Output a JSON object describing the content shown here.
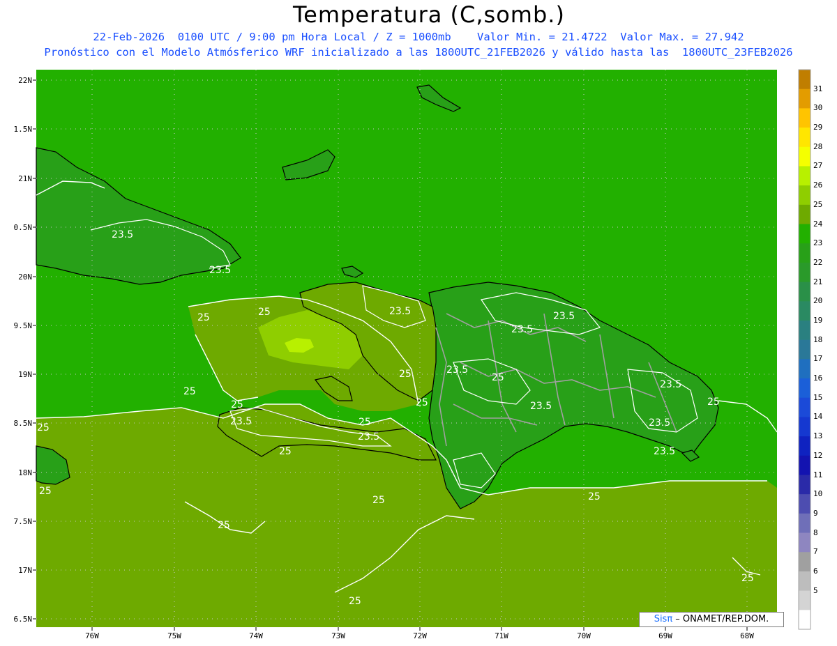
{
  "title": "Temperatura (C,somb.)",
  "subtitle_line1": "22-Feb-2026  0100 UTC / 9:00 pm Hora Local / Z = 1000mb    Valor Min. = 21.4722  Valor Max. = 27.942",
  "subtitle_line2": "Pronóstico con el Modelo Atmósferico WRF inicializado a las 1800UTC_21FEB2026 y válido hasta las  1800UTC_23FEB2026",
  "y_axis_labels": [
    "22N",
    "1.5N",
    "21N",
    "0.5N",
    "20N",
    "9.5N",
    "19N",
    "8.5N",
    "18N",
    "7.5N",
    "17N",
    "6.5N"
  ],
  "x_axis_labels": [
    "76W",
    "75W",
    "74W",
    "73W",
    "72W",
    "71W",
    "70W",
    "69W",
    "68W"
  ],
  "legend": {
    "labels": [
      "31",
      "30",
      "29",
      "28",
      "27",
      "26",
      "25",
      "24",
      "23",
      "22",
      "21",
      "20",
      "19",
      "18",
      "17",
      "16",
      "15",
      "14",
      "13",
      "12",
      "11",
      "10",
      "9",
      "8",
      "7",
      "6",
      "5"
    ],
    "colors": [
      "#c07e00",
      "#e39c00",
      "#ffc400",
      "#ffe600",
      "#f5ff00",
      "#b8f000",
      "#8fce00",
      "#6eaa00",
      "#22b000",
      "#28a018",
      "#2a9a2a",
      "#2a9048",
      "#2a8a62",
      "#2a8080",
      "#2a7898",
      "#1f6fbf",
      "#1b5fd8",
      "#1b4ad8",
      "#1538d0",
      "#0f22c0",
      "#1313b0",
      "#2a2aa8",
      "#4d4db0",
      "#6f6fb8",
      "#8e86c0",
      "#a0a0a0",
      "#bdbdbd",
      "#d4d4d4",
      "#ffffff"
    ]
  },
  "contour_labels": [
    "23.5",
    "23.5",
    "23.5",
    "23.5",
    "23.5",
    "23.5",
    "23.5",
    "23.5",
    "23.5",
    "23.5",
    "23.5",
    "23.5",
    "25",
    "25",
    "25",
    "25",
    "25",
    "25",
    "25",
    "25",
    "25",
    "25",
    "25",
    "25",
    "25",
    "25",
    "25",
    "25"
  ],
  "credit": {
    "brand": "Sisπ",
    "text": " – ONAMET/REP.DOM."
  },
  "colors": {
    "sea": "#22b000",
    "warm": "#6eaa00",
    "warmer": "#8fce00",
    "hot": "#b8f000",
    "cool": "#28a018",
    "contour": "#ffffff",
    "coast": "#000000",
    "border": "#a0a0a0",
    "grid": "#c8c8c8"
  }
}
